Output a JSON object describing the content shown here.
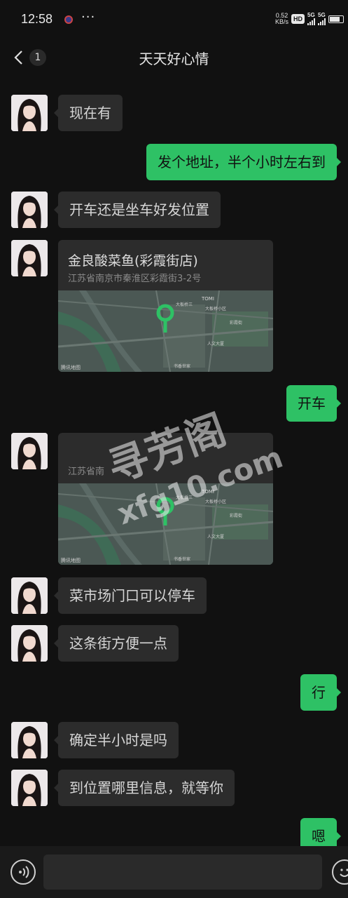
{
  "status_bar": {
    "time": "12:58",
    "more": "···",
    "net_speed_top": "0.52",
    "net_speed_unit": "KB/s",
    "hd": "HD",
    "sig1_label": "5G",
    "sig2_label": "5G"
  },
  "header": {
    "unread_count": "1",
    "title": "天天好心情"
  },
  "messages": [
    {
      "from": "them",
      "text": "现在有"
    },
    {
      "from": "me",
      "text": "发个地址，半个小时左右到"
    },
    {
      "from": "them",
      "text": "开车还是坐车好发位置"
    },
    {
      "from": "them",
      "type": "location",
      "name": "金良酸菜鱼(彩霞街店)",
      "address": "江苏省南京市秦淮区彩霞街3-2号"
    },
    {
      "from": "me",
      "text": "开车"
    },
    {
      "from": "them",
      "type": "location",
      "name": "",
      "address": "江苏省南"
    },
    {
      "from": "them",
      "text": "菜市场门口可以停车"
    },
    {
      "from": "them",
      "text": "这条街方便一点"
    },
    {
      "from": "me",
      "text": "行"
    },
    {
      "from": "them",
      "text": "确定半小时是吗"
    },
    {
      "from": "them",
      "text": "到位置哪里信息，就等你"
    },
    {
      "from": "me",
      "text": "嗯"
    }
  ],
  "map": {
    "labels": [
      "TOMI",
      "大板桥三",
      "大板桥小区",
      "书香世家",
      "彩霞街",
      "人文大厦",
      "腾讯地图"
    ]
  },
  "watermark": {
    "line1": "寻芳阁",
    "line2": "xfg10.com"
  },
  "input": {
    "placeholder": ""
  },
  "colors": {
    "background": "#111111",
    "bubble_in": "#2c2c2c",
    "bubble_out": "#2ec165"
  }
}
